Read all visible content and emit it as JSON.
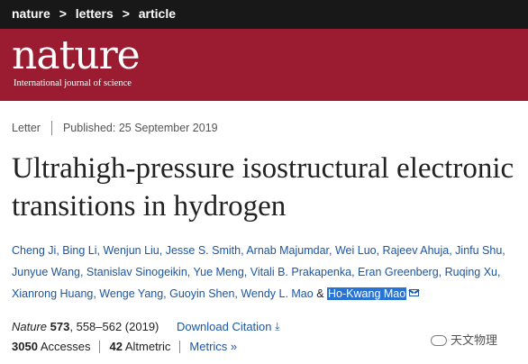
{
  "breadcrumb": [
    "nature",
    "letters",
    "article"
  ],
  "breadcrumb_separator": ">",
  "brand": {
    "name": "nature",
    "tagline": "International journal of science",
    "bar_color": "#181818",
    "masthead_color": "#9b1b30"
  },
  "article": {
    "type": "Letter",
    "published": "Published: 25 September 2019",
    "title": "Ultrahigh-pressure isostructural electronic transitions in hydrogen",
    "authors_line1": "Cheng Ji, Bing Li, Wenjun Liu, Jesse S. Smith, Arnab Majumdar, Wei Luo, Rajeev Ahuja, Jinfu Shu,",
    "authors_line2": "Junyue Wang, Stanislav Sinogeikin, Yue Meng, Vitali B. Prakapenka, Eran Greenberg, Ruqing Xu,",
    "authors_line3_pre": "Xianrong Huang, Wenge Yang, Guoyin Shen, Wendy L. Mao",
    "authors_amp": "&",
    "corresponding_author": "Ho-Kwang Mao",
    "journal": "Nature",
    "volume": "573",
    "pages": ", 558–562 (2019)",
    "download_label": "Download Citation",
    "accesses_count": "3050",
    "accesses_label": "Accesses",
    "altmetric_count": "42",
    "altmetric_label": "Altmetric",
    "metrics_label": "Metrics"
  },
  "icons": {
    "mail": "envelope-icon",
    "download": "download-arrow-icon",
    "metrics": "double-chevron-icon"
  },
  "watermark": "天文物理",
  "link_color": "#1a56a5",
  "highlight_color": "#2874d5"
}
